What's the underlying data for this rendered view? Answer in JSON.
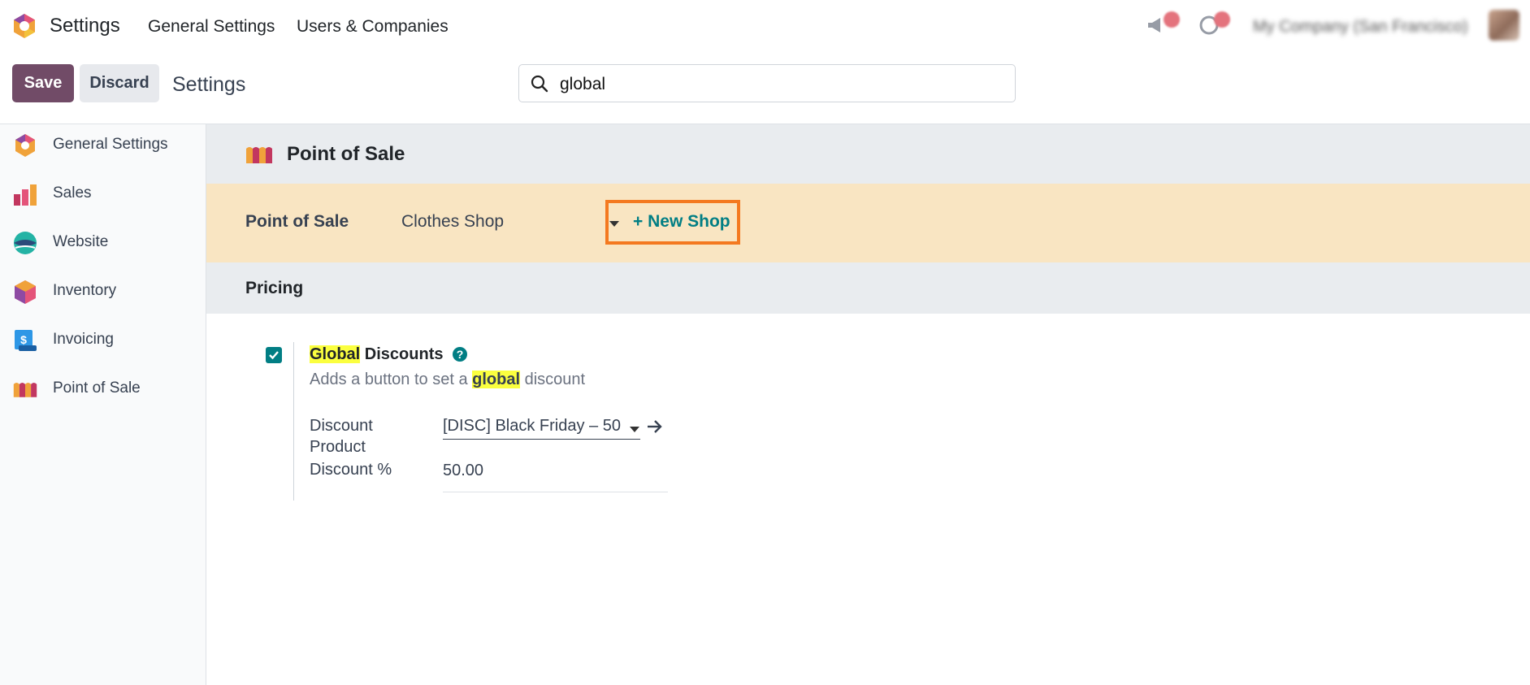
{
  "app": {
    "name": "Settings"
  },
  "top_menu": [
    {
      "label": "General Settings"
    },
    {
      "label": "Users & Companies"
    }
  ],
  "systray": {
    "company": "My Company (San Francisco)"
  },
  "control": {
    "save_label": "Save",
    "discard_label": "Discard",
    "breadcrumb": "Settings"
  },
  "search": {
    "value": "global",
    "placeholder": "Search..."
  },
  "sidebar": {
    "items": [
      {
        "label": "General Settings",
        "icon": "settings-icon"
      },
      {
        "label": "Sales",
        "icon": "sales-icon"
      },
      {
        "label": "Website",
        "icon": "website-icon"
      },
      {
        "label": "Inventory",
        "icon": "inventory-icon"
      },
      {
        "label": "Invoicing",
        "icon": "invoicing-icon"
      },
      {
        "label": "Point of Sale",
        "icon": "point-of-sale-icon"
      }
    ]
  },
  "section": {
    "title": "Point of Sale",
    "shop_label": "Point of Sale",
    "shop_selected": "Clothes Shop",
    "new_shop_label": "+ New Shop",
    "subsection_title": "Pricing"
  },
  "setting": {
    "checked": true,
    "title_highlight": "Global",
    "title_rest": " Discounts",
    "desc_before": "Adds a button to set a ",
    "desc_highlight": "global",
    "desc_after": " discount",
    "discount_product_label_1": "Discount",
    "discount_product_label_2": "Product",
    "discount_product_value": "[DISC] Black Friday – 50",
    "discount_pct_label": "Discount %",
    "discount_pct_value": "50.00"
  },
  "colors": {
    "brand": "#714b67",
    "accent": "#017e84",
    "shop_bar": "#f9e5c2",
    "highlight": "#fbff3f",
    "focus_outline": "#f47920"
  }
}
